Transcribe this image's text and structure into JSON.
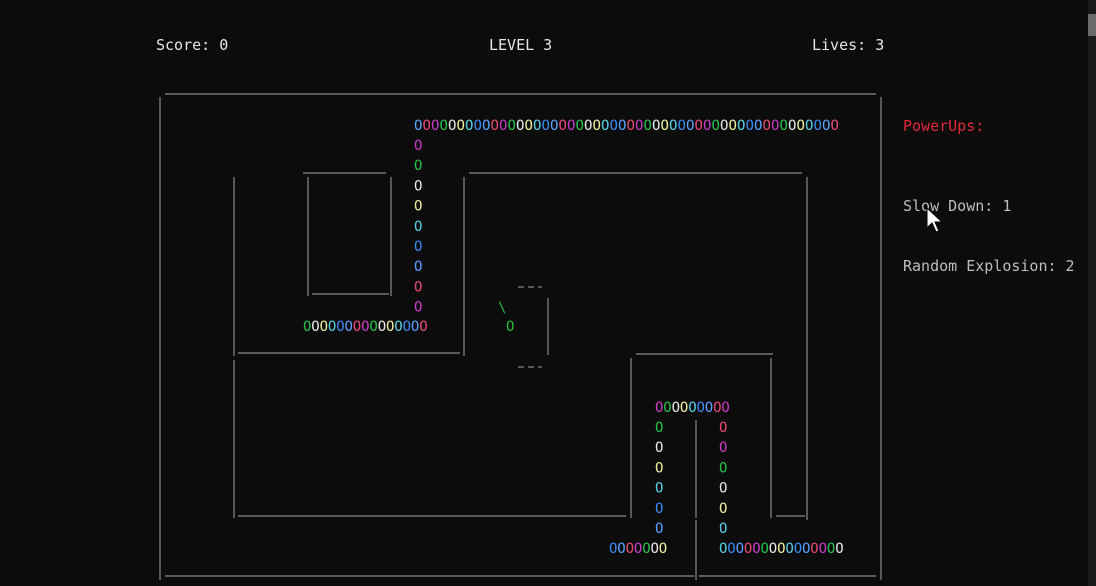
{
  "hud": {
    "score_label": "Score: 0",
    "level_label": "LEVEL 3",
    "lives_label": "Lives: 3"
  },
  "powerups": {
    "title": "PowerUps:",
    "items": [
      {
        "label": "Slow Down: 1"
      },
      {
        "label": "Random Explosion: 2"
      }
    ]
  },
  "game": {
    "snake_head_char": "O",
    "snake_neck_char": "\\",
    "segment_char": "O",
    "colors": {
      "wall": "#8a8a8a",
      "snake": "#2bbf3a",
      "palette": [
        "#5aa0ff",
        "#e84a78",
        "#c83cc8",
        "#27c24a",
        "#e8e8e8",
        "#f0f0a0",
        "#5ad0e8",
        "#3a8cf0"
      ]
    }
  }
}
